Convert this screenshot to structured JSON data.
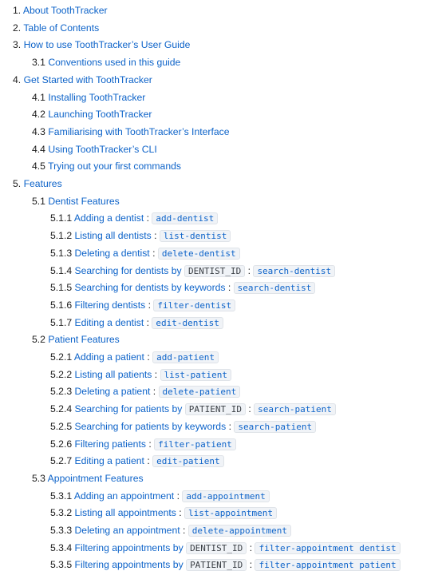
{
  "items": [
    {
      "num": "1.",
      "text": "About ToothTracker"
    },
    {
      "num": "2.",
      "text": "Table of Contents"
    },
    {
      "num": "3.",
      "text": "How to use ToothTracker’s User Guide"
    },
    {
      "num": "3.1",
      "text": "Conventions used in this guide"
    },
    {
      "num": "4.",
      "text": "Get Started with ToothTracker"
    },
    {
      "num": "4.1",
      "text": "Installing ToothTracker"
    },
    {
      "num": "4.2",
      "text": "Launching ToothTracker"
    },
    {
      "num": "4.3",
      "text": "Familiarising with ToothTracker’s Interface"
    },
    {
      "num": "4.4",
      "text": "Using ToothTracker’s CLI"
    },
    {
      "num": "4.5",
      "text": "Trying out your first commands"
    },
    {
      "num": "5.",
      "text": "Features"
    },
    {
      "num": "5.1",
      "text": "Dentist Features"
    },
    {
      "num": "5.1.1",
      "text": "Adding a dentist",
      "cmd": "add-dentist"
    },
    {
      "num": "5.1.2",
      "text": "Listing all dentists",
      "cmd": "list-dentist"
    },
    {
      "num": "5.1.3",
      "text": "Deleting a dentist",
      "cmd": "delete-dentist"
    },
    {
      "num": "5.1.4",
      "text": "Searching for dentists by",
      "param": "DENTIST_ID",
      "cmd": "search-dentist"
    },
    {
      "num": "5.1.5",
      "text": "Searching for dentists by keywords",
      "cmd": "search-dentist"
    },
    {
      "num": "5.1.6",
      "text": "Filtering dentists",
      "cmd": "filter-dentist"
    },
    {
      "num": "5.1.7",
      "text": "Editing a dentist",
      "cmd": "edit-dentist"
    },
    {
      "num": "5.2",
      "text": "Patient Features"
    },
    {
      "num": "5.2.1",
      "text": "Adding a patient",
      "cmd": "add-patient"
    },
    {
      "num": "5.2.2",
      "text": "Listing all patients",
      "cmd": "list-patient"
    },
    {
      "num": "5.2.3",
      "text": "Deleting a patient",
      "cmd": "delete-patient"
    },
    {
      "num": "5.2.4",
      "text": "Searching for patients by",
      "param": "PATIENT_ID",
      "cmd": "search-patient"
    },
    {
      "num": "5.2.5",
      "text": "Searching for patients by keywords",
      "cmd": "search-patient"
    },
    {
      "num": "5.2.6",
      "text": "Filtering patients",
      "cmd": "filter-patient"
    },
    {
      "num": "5.2.7",
      "text": "Editing a patient",
      "cmd": "edit-patient"
    },
    {
      "num": "5.3",
      "text": "Appointment Features"
    },
    {
      "num": "5.3.1",
      "text": "Adding an appointment",
      "cmd": "add-appointment"
    },
    {
      "num": "5.3.2",
      "text": "Listing all appointments",
      "cmd": "list-appointment"
    },
    {
      "num": "5.3.3",
      "text": "Deleting an appointment",
      "cmd": "delete-appointment"
    },
    {
      "num": "5.3.4",
      "text": "Filtering appointments by",
      "param": "DENTIST_ID",
      "cmd": "filter-appointment dentist"
    },
    {
      "num": "5.3.5",
      "text": "Filtering appointments by",
      "param": "PATIENT_ID",
      "cmd": "filter-appointment patient"
    }
  ],
  "separator": ":"
}
